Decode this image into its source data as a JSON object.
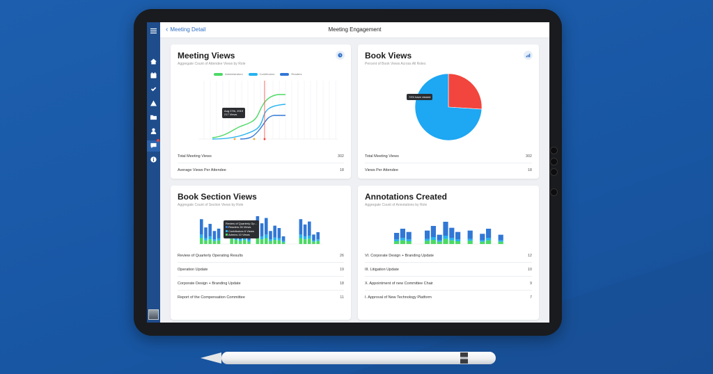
{
  "header": {
    "back_label": "Meeting Detail",
    "title": "Meeting Engagement"
  },
  "sidebar": {
    "items": [
      {
        "name": "menu-icon"
      },
      {
        "name": "home-icon"
      },
      {
        "name": "calendar-icon"
      },
      {
        "name": "check-icon"
      },
      {
        "name": "warning-icon"
      },
      {
        "name": "folder-icon"
      },
      {
        "name": "person-icon"
      },
      {
        "name": "chat-icon",
        "active": true,
        "badge": true
      },
      {
        "name": "info-icon"
      }
    ]
  },
  "meeting_views": {
    "title": "Meeting Views",
    "subtitle": "Aggregate Count of Attendee Views by Role",
    "legend": [
      "Administrators",
      "Contributors",
      "Readers"
    ],
    "tooltip": {
      "date": "Aug 27th, 2019",
      "views": "217 Views"
    },
    "stats": [
      {
        "label": "Total Meeting Views",
        "value": "302"
      },
      {
        "label": "Average Views Per Attendee",
        "value": "18"
      }
    ]
  },
  "book_views": {
    "title": "Book Views",
    "subtitle": "Percent of Book Views Across All Roles",
    "tooltip": "74% have viewed",
    "stats": [
      {
        "label": "Total Meeting Views",
        "value": "302"
      },
      {
        "label": "Views Per Attendee",
        "value": "18"
      }
    ]
  },
  "book_section_views": {
    "title": "Book Section Views",
    "subtitle": "Aggregate Count of Section Views by Role",
    "tooltip": {
      "title": "Review of Quarterly Op...",
      "readers": "Readers 26 Views",
      "contributors": "Contributors 6 Views",
      "admins": "Admins 10 Views"
    },
    "rows": [
      {
        "label": "Review of Quarterly Operating Results",
        "value": "26"
      },
      {
        "label": "Operation Update",
        "value": "19"
      },
      {
        "label": "Corporate Design + Branding Update",
        "value": "18"
      },
      {
        "label": "Report of the Compensation Committee",
        "value": "11"
      }
    ]
  },
  "annotations_created": {
    "title": "Annotations Created",
    "subtitle": "Aggregate Count of Annotations by Role",
    "rows": [
      {
        "label": "VI.  Corporate Design + Branding Update",
        "value": "12"
      },
      {
        "label": "III.  Litigation Update",
        "value": "10"
      },
      {
        "label": "X.  Appointment of new Committee Chair",
        "value": "9"
      },
      {
        "label": "I.  Approval of New Technology Platform",
        "value": "7"
      }
    ]
  },
  "colors": {
    "admins": "#4cd964",
    "contributors": "#25b3f0",
    "readers": "#3177d6",
    "pie_viewed": "#1ea7f2",
    "pie_not_viewed": "#f2453d",
    "sidebar": "#1f4d8c",
    "accent": "#2f6fc4"
  },
  "chart_data": [
    {
      "type": "line",
      "series_names": [
        "Administrators",
        "Contributors",
        "Readers"
      ]
    },
    {
      "type": "pie",
      "slices": [
        {
          "label": "viewed",
          "value": 74
        },
        {
          "label": "not viewed",
          "value": 26
        }
      ]
    },
    {
      "type": "bar",
      "stacked": true,
      "series_names": [
        "Readers",
        "Contributors",
        "Admins"
      ],
      "readers": [
        26,
        18,
        21,
        14,
        16,
        0,
        0,
        24,
        20,
        15,
        18,
        11,
        0,
        30,
        22,
        28,
        14,
        20,
        17,
        8,
        0,
        0,
        0,
        26,
        20,
        24,
        10,
        12
      ],
      "contributors": [
        6,
        4,
        5,
        3,
        4,
        0,
        0,
        5,
        4,
        3,
        4,
        3,
        0,
        6,
        5,
        6,
        3,
        4,
        4,
        2,
        0,
        0,
        0,
        6,
        5,
        5,
        2,
        3
      ],
      "admins": [
        10,
        6,
        8,
        5,
        6,
        0,
        0,
        9,
        7,
        5,
        7,
        4,
        0,
        11,
        8,
        10,
        5,
        7,
        6,
        3,
        0,
        0,
        0,
        10,
        8,
        9,
        4,
        5
      ]
    },
    {
      "type": "bar",
      "stacked": true,
      "series_names": [
        "Readers",
        "Contributors",
        "Admins"
      ],
      "readers": [
        14,
        20,
        16,
        0,
        0,
        18,
        24,
        12,
        30,
        22,
        16,
        0,
        18,
        0,
        14,
        20,
        0,
        12
      ],
      "contributors": [
        4,
        5,
        4,
        0,
        0,
        4,
        6,
        3,
        7,
        5,
        4,
        0,
        4,
        0,
        3,
        5,
        0,
        3
      ],
      "admins": [
        6,
        8,
        6,
        0,
        0,
        7,
        9,
        5,
        11,
        8,
        6,
        0,
        7,
        0,
        5,
        8,
        0,
        5
      ]
    }
  ]
}
